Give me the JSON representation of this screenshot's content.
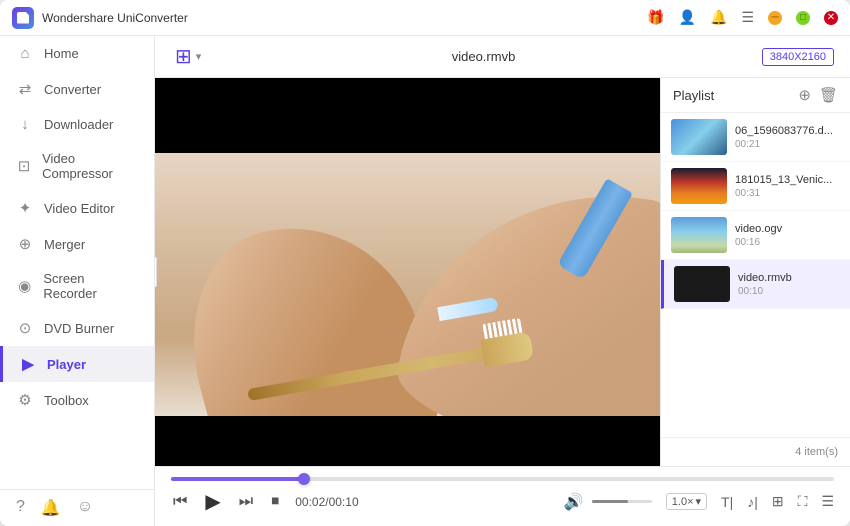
{
  "titleBar": {
    "appName": "Wondershare UniConverter",
    "windowControls": [
      "minimize",
      "maximize",
      "close"
    ]
  },
  "sidebar": {
    "items": [
      {
        "id": "home",
        "label": "Home",
        "icon": "🏠"
      },
      {
        "id": "converter",
        "label": "Converter",
        "icon": "🔄"
      },
      {
        "id": "downloader",
        "label": "Downloader",
        "icon": "⬇"
      },
      {
        "id": "video-compressor",
        "label": "Video Compressor",
        "icon": "🗜"
      },
      {
        "id": "video-editor",
        "label": "Video Editor",
        "icon": "✂"
      },
      {
        "id": "merger",
        "label": "Merger",
        "icon": "🔗"
      },
      {
        "id": "screen-recorder",
        "label": "Screen Recorder",
        "icon": "⏺"
      },
      {
        "id": "dvd-burner",
        "label": "DVD Burner",
        "icon": "💿"
      },
      {
        "id": "player",
        "label": "Player",
        "icon": "▶",
        "active": true
      },
      {
        "id": "toolbox",
        "label": "Toolbox",
        "icon": "🧰"
      }
    ],
    "bottomIcons": [
      "❓",
      "🔔",
      "😊"
    ]
  },
  "playerTopbar": {
    "filename": "video.rmvb",
    "resolution": "3840X2160"
  },
  "playlist": {
    "title": "Playlist",
    "itemCount": "4 item(s)",
    "items": [
      {
        "id": 1,
        "name": "06_1596083776.d...",
        "duration": "00:21",
        "thumb": "landscape"
      },
      {
        "id": 2,
        "name": "181015_13_Venic...",
        "duration": "00:31",
        "thumb": "sunset"
      },
      {
        "id": 3,
        "name": "video.ogv",
        "duration": "00:16",
        "thumb": "statue"
      },
      {
        "id": 4,
        "name": "video.rmvb",
        "duration": "00:10",
        "thumb": "dark",
        "active": true
      }
    ]
  },
  "controls": {
    "currentTime": "00:02",
    "totalTime": "00:10",
    "timeDisplay": "00:02/00:10",
    "speedLabel": "1.0×",
    "speedChevron": "▾"
  }
}
